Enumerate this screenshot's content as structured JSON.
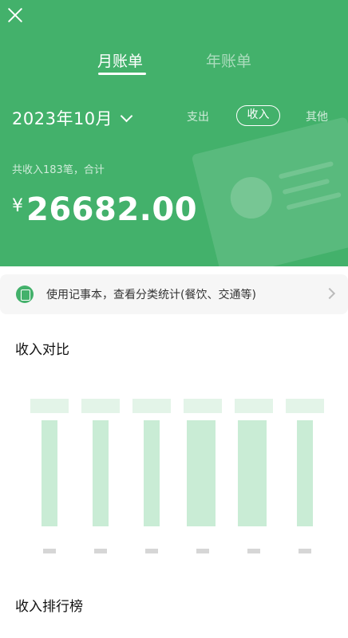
{
  "header": {
    "tabs": [
      "月账单",
      "年账单"
    ],
    "month": "2023年10月",
    "filters": [
      "支出",
      "收入",
      "其他"
    ],
    "summary_label": "共收入183笔，合计",
    "currency": "¥",
    "amount": "26682.00",
    "accent_color": "#43b16b"
  },
  "banner": {
    "text": "使用记事本，查看分类统计(餐饮、交通等)"
  },
  "sections": {
    "compare_title": "收入对比",
    "ranking_title": "收入排行榜"
  },
  "chart_data": {
    "type": "bar",
    "title": "收入对比",
    "categories": [
      "",
      "",
      "",
      "",
      "",
      ""
    ],
    "values": [
      0.95,
      0.95,
      0.95,
      0.95,
      0.95,
      0.95
    ]
  }
}
